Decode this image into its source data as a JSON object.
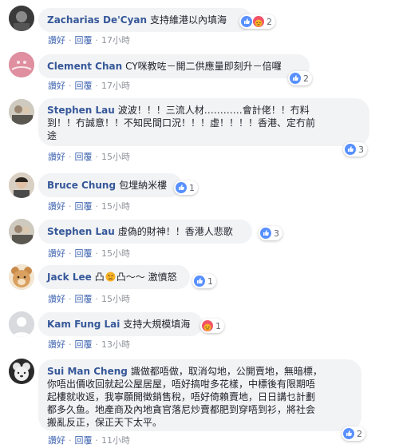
{
  "comments": [
    {
      "author": "Zacharias De'Cyan",
      "text": "支持維港以內填海",
      "reaction_count": "2",
      "reactions": [
        "like-icon",
        "angry-icon"
      ],
      "time": "17小時"
    },
    {
      "author": "Clement Chan",
      "text": "CY咪教咗－開二供應量即刻升－倍囉",
      "reaction_count": "2",
      "reactions": [
        "like-icon"
      ],
      "time": "17小時"
    },
    {
      "author": "Stephen Lau",
      "text_lines": [
        "波波！！！三流人材…………會計佬！！冇料",
        "到！！冇誠意！！不知民間口況！！！虛！！！！香港、定冇前",
        "途"
      ],
      "reaction_count": "3",
      "reactions": [
        "like-icon"
      ],
      "time": "15小時"
    },
    {
      "author": "Bruce Chung",
      "text": "包埋納米樓",
      "reaction_count": "1",
      "reactions": [
        "like-icon"
      ],
      "time": "15小時"
    },
    {
      "author": "Stephen Lau",
      "text": "虛偽的財神！！香港人悲歌",
      "reaction_count": "3",
      "reactions": [
        "like-icon"
      ],
      "time": "15小時"
    },
    {
      "author": "Jack Lee",
      "text_before": "凸",
      "text_middle": "凸～～ 激憤怒",
      "reaction_count": "1",
      "reactions": [
        "like-icon"
      ],
      "time": "15小時"
    },
    {
      "author": "Kam Fung Lai",
      "text": "支持大規模填海",
      "reaction_count": "1",
      "reactions": [
        "angry-icon"
      ],
      "time": "13小時"
    },
    {
      "author": "Sui Man Cheng",
      "text_lines": [
        "識做都唔做，取消勾地，公開賣地，無暗標，",
        "你唔出價收回就起公屋居屋，唔好搞咁多花樣，中標後有限期唔",
        "起樓就收返，我寧願開徵銷售稅，唔好倚賴賣地，日日講乜計劃",
        "都多久鱼。地產商及內地貪官落尼炒賣都肥到穿唔到衫，將社会",
        "搬亂反正，保正天下太平。"
      ],
      "reaction_count": "2",
      "reactions": [
        "like-icon"
      ],
      "time": "11小時"
    }
  ],
  "labels": {
    "like": "讚好",
    "reply": "回覆",
    "dot": "·"
  },
  "colors": {
    "author": "#365899",
    "bubble": "#f2f3f5",
    "link": "#4267b2",
    "like": "#5890ff",
    "angry": "#f25268"
  }
}
